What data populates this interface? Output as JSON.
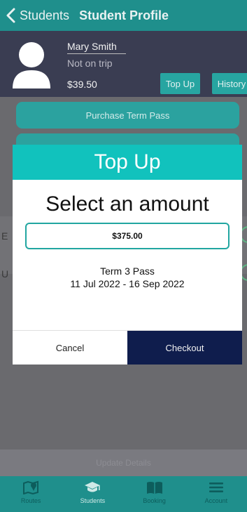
{
  "header": {
    "back_label": "Students",
    "title": "Student Profile"
  },
  "profile": {
    "name": "Mary Smith",
    "status": "Not on trip",
    "balance": "$39.50",
    "topup_label": "Top Up",
    "history_label": "History"
  },
  "actions": {
    "purchase_label": "Purchase Term Pass"
  },
  "background_rows": [
    {
      "letter": "E"
    },
    {
      "letter": "U"
    }
  ],
  "modal": {
    "title": "Top Up",
    "subtitle": "Select an amount",
    "amount": "$375.00",
    "pass_name": "Term 3 Pass",
    "pass_dates": "11 Jul 2022 - 16 Sep 2022",
    "cancel_label": "Cancel",
    "checkout_label": "Checkout"
  },
  "update_details_label": "Update Details",
  "bottom_nav": {
    "items": [
      {
        "label": "Routes",
        "icon": "map-icon"
      },
      {
        "label": "Students",
        "icon": "graduation-cap-icon"
      },
      {
        "label": "Booking",
        "icon": "book-icon"
      },
      {
        "label": "Account",
        "icon": "menu-icon"
      }
    ]
  },
  "colors": {
    "teal": "#1f8f8c",
    "modal_header": "#11c2bd",
    "checkout": "#0f1d4d"
  }
}
